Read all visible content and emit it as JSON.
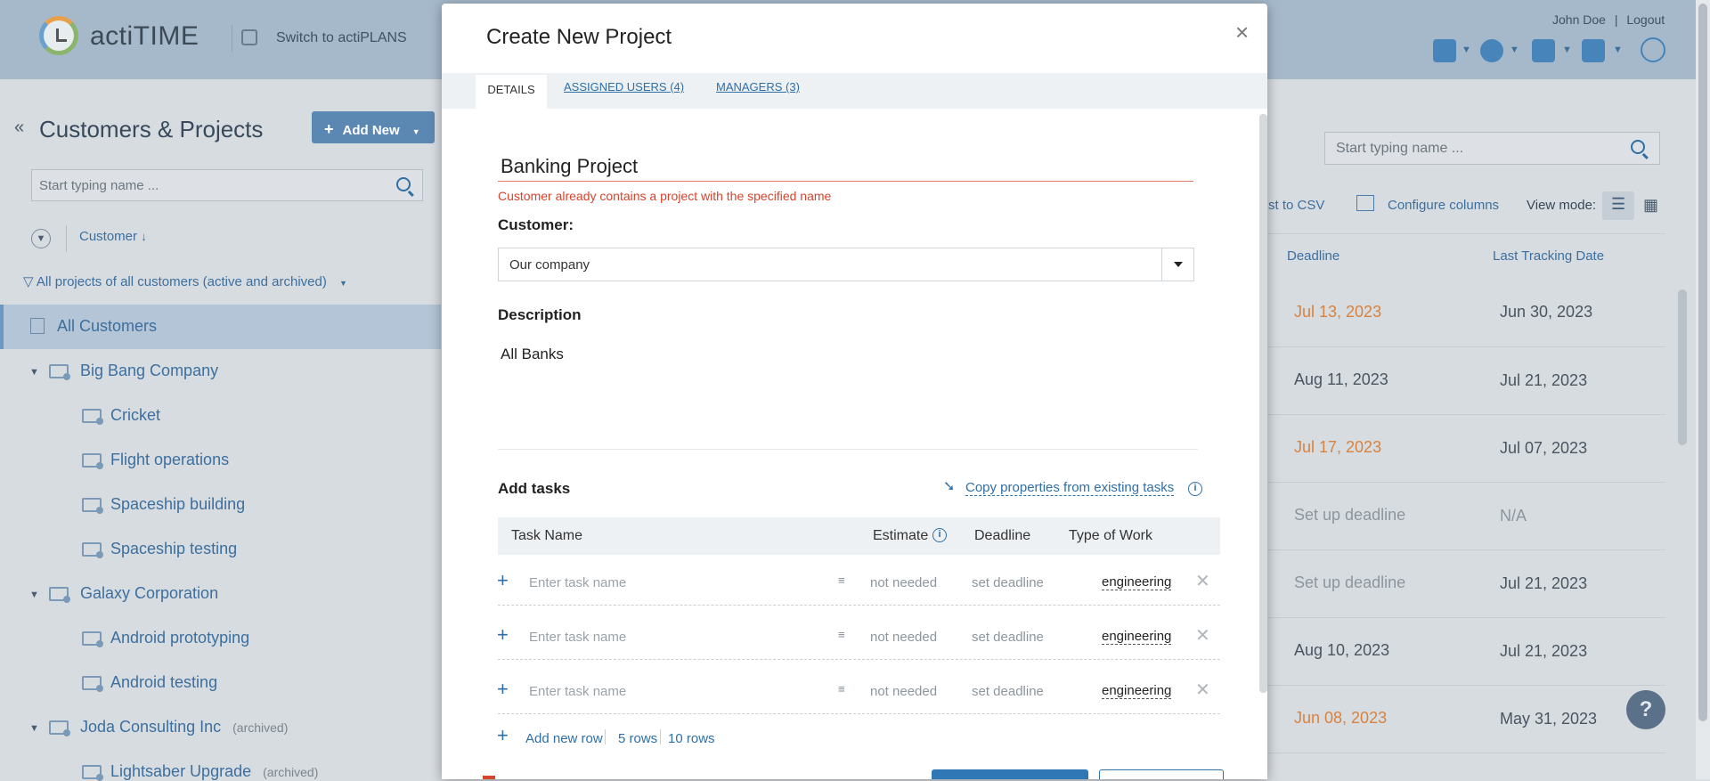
{
  "app": {
    "logo_text": "actiTIME",
    "switch_label": "Switch to actiPLANS",
    "user_name": "John Doe",
    "user_sep": "|",
    "logout_label": "Logout"
  },
  "sidebar": {
    "title": "Customers & Projects",
    "add_new_label": "Add New",
    "search_placeholder": "Start typing name ...",
    "sort_label": "Customer",
    "filter_label": "All projects of all customers (active and archived)",
    "all_customers_label": "All Customers",
    "tree": [
      {
        "label": "Big Bang Company",
        "level": 0,
        "archived": ""
      },
      {
        "label": "Cricket",
        "level": 1,
        "archived": ""
      },
      {
        "label": "Flight operations",
        "level": 1,
        "archived": ""
      },
      {
        "label": "Spaceship building",
        "level": 1,
        "archived": ""
      },
      {
        "label": "Spaceship testing",
        "level": 1,
        "archived": ""
      },
      {
        "label": "Galaxy Corporation",
        "level": 0,
        "archived": ""
      },
      {
        "label": "Android prototyping",
        "level": 1,
        "archived": ""
      },
      {
        "label": "Android testing",
        "level": 1,
        "archived": ""
      },
      {
        "label": "Joda Consulting Inc",
        "level": 0,
        "archived": "(archived)"
      },
      {
        "label": "Lightsaber Upgrade",
        "level": 1,
        "archived": "(archived)"
      }
    ]
  },
  "right_panel": {
    "search_placeholder": "Start typing name ...",
    "export_label": "st to CSV",
    "configure_label": "Configure columns",
    "view_mode_label": "View mode:",
    "col_deadline": "Deadline",
    "col_last_tracking": "Last Tracking Date",
    "rows": [
      {
        "deadline": "Jul 13, 2023",
        "deadline_style": "orange",
        "last": "Jun 30, 2023"
      },
      {
        "deadline": "Aug 11, 2023",
        "deadline_style": "",
        "last": "Jul 21, 2023"
      },
      {
        "deadline": "Jul 17, 2023",
        "deadline_style": "orange",
        "last": "Jul 07, 2023"
      },
      {
        "deadline": "Set up deadline",
        "deadline_style": "muted",
        "last": "N/A"
      },
      {
        "deadline": "Set up deadline",
        "deadline_style": "muted",
        "last": "Jul 21, 2023"
      },
      {
        "deadline": "Aug 10, 2023",
        "deadline_style": "",
        "last": "Jul 21, 2023"
      },
      {
        "deadline": "Jun 08, 2023",
        "deadline_style": "orange",
        "last": "May 31, 2023"
      }
    ],
    "help_label": "?"
  },
  "modal": {
    "title": "Create New Project",
    "close_label": "×",
    "tabs": [
      "DETAILS",
      "ASSIGNED USERS (4)",
      "MANAGERS (3)"
    ],
    "project_name": "Banking Project",
    "error": "Customer already contains a project with the specified name",
    "customer_label": "Customer:",
    "customer_value": "Our company",
    "description_label": "Description",
    "description_value": "All Banks",
    "add_tasks_label": "Add tasks",
    "copy_label": "Copy properties from existing tasks",
    "table_headers": {
      "task": "Task Name",
      "estimate": "Estimate",
      "deadline": "Deadline",
      "type": "Type of Work"
    },
    "task_rows": [
      {
        "placeholder": "Enter task name",
        "estimate": "not needed",
        "deadline": "set deadline",
        "type": "engineering"
      },
      {
        "placeholder": "Enter task name",
        "estimate": "not needed",
        "deadline": "set deadline",
        "type": "engineering"
      },
      {
        "placeholder": "Enter task name",
        "estimate": "not needed",
        "deadline": "set deadline",
        "type": "engineering"
      }
    ],
    "add_row_label": "Add new row",
    "five_rows_label": "5 rows",
    "ten_rows_label": "10 rows"
  }
}
